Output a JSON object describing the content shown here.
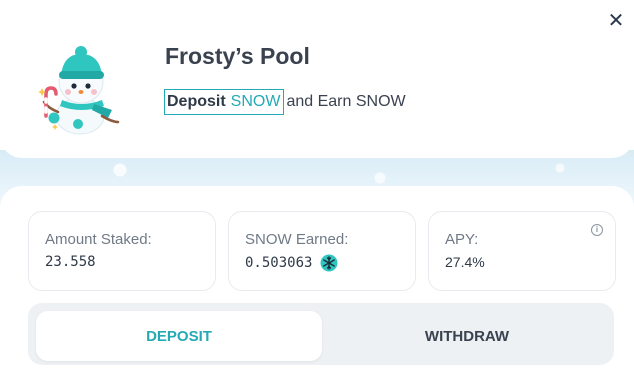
{
  "header": {
    "close_symbol": "✕",
    "close_icon": "close-icon",
    "mascot_icon": "snowman-icon",
    "title": "Frosty’s Pool",
    "subtitle": {
      "deposit_label": "Deposit",
      "token": "SNOW",
      "suffix": "and Earn SNOW"
    }
  },
  "stats": [
    {
      "label": "Amount Staked:",
      "value": "23.558"
    },
    {
      "label": "SNOW Earned:",
      "value": "0.503063",
      "icon": "snowflake-icon"
    },
    {
      "label": "APY:",
      "value": "27.4%",
      "info_icon": "info-icon",
      "info_symbol": "i"
    }
  ],
  "toggle": {
    "deposit_label": "DEPOSIT",
    "withdraw_label": "WITHDRAW",
    "active": "deposit"
  },
  "colors": {
    "accent": "#23aab4",
    "text_dark": "#2f3a48",
    "text_muted": "#707a86",
    "toggle_bg": "#eef1f4"
  }
}
